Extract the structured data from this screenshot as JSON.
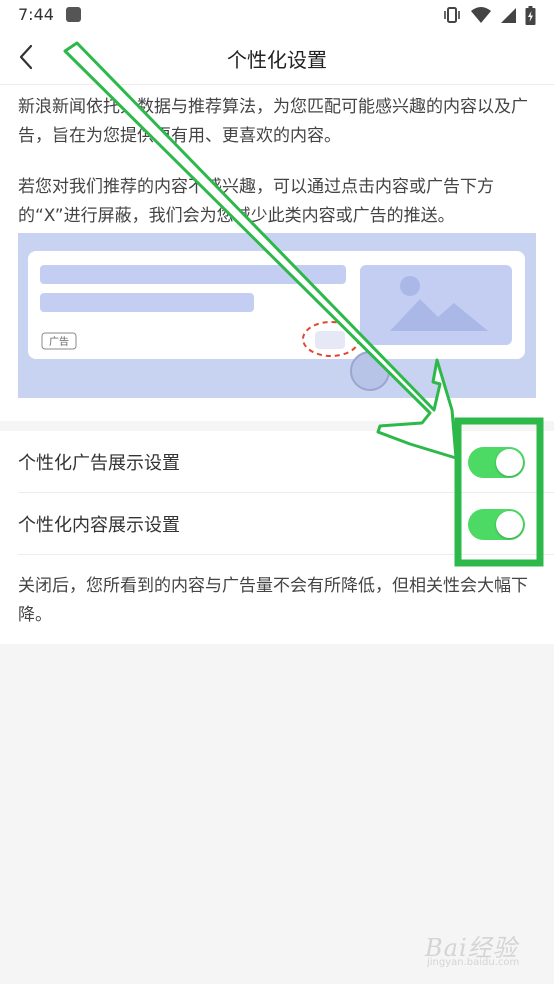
{
  "status_bar": {
    "time": "7:44",
    "icons": [
      "app-notification-icon",
      "vibrate-icon",
      "wifi-icon",
      "signal-icon",
      "battery-charging-icon"
    ]
  },
  "header": {
    "back_icon": "chevron-left-icon",
    "title": "个性化设置"
  },
  "intro": {
    "paragraph_1": "新浪新闻依托大数据与推荐算法，为您匹配可能感兴趣的内容以及广告，旨在为您提供更有用、更喜欢的内容。",
    "paragraph_2": "若您对我们推荐的内容不感兴趣，可以通过点击内容或广告下方的“X”进行屏蔽，我们会为您减少此类内容或广告的推送。",
    "illustration_ad_tag": "广告"
  },
  "settings": {
    "items": [
      {
        "label": "个性化广告展示设置",
        "enabled": true
      },
      {
        "label": "个性化内容展示设置",
        "enabled": true
      }
    ],
    "note": "关闭后，您所看到的内容与广告量不会有所降低，但相关性会大幅下降。"
  },
  "watermark": {
    "brand": "Bai经验",
    "url": "jingyan.baidu.com"
  },
  "colors": {
    "toggle_on": "#4cd964",
    "annotation_green": "#2db84a",
    "illustration_bg": "#c8d3f1",
    "illustration_block": "#c4cef2",
    "dashed_circle": "#e0472f"
  }
}
